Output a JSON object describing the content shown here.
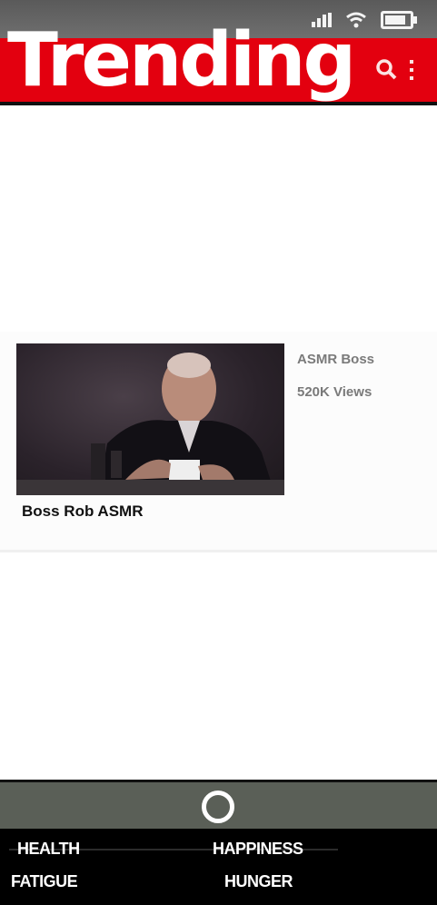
{
  "status_bar": {
    "icons": [
      "signal-icon",
      "wifi-icon",
      "battery-icon"
    ],
    "battery_level": 0.85
  },
  "header": {
    "title": "Trending",
    "background_color": "#e3000f",
    "actions": [
      "search-icon",
      "more-vert-icon"
    ]
  },
  "videos": [
    {
      "title": "Boss Rob ASMR",
      "channel": "ASMR Boss",
      "views": "520K Views"
    }
  ],
  "home_bar": {
    "button_icon": "home-circle-icon"
  },
  "stats": {
    "health_label": "HEALTH",
    "happiness_label": "HAPPINESS",
    "fatigue_label": "FATIGUE",
    "hunger_label": "HUNGER"
  }
}
